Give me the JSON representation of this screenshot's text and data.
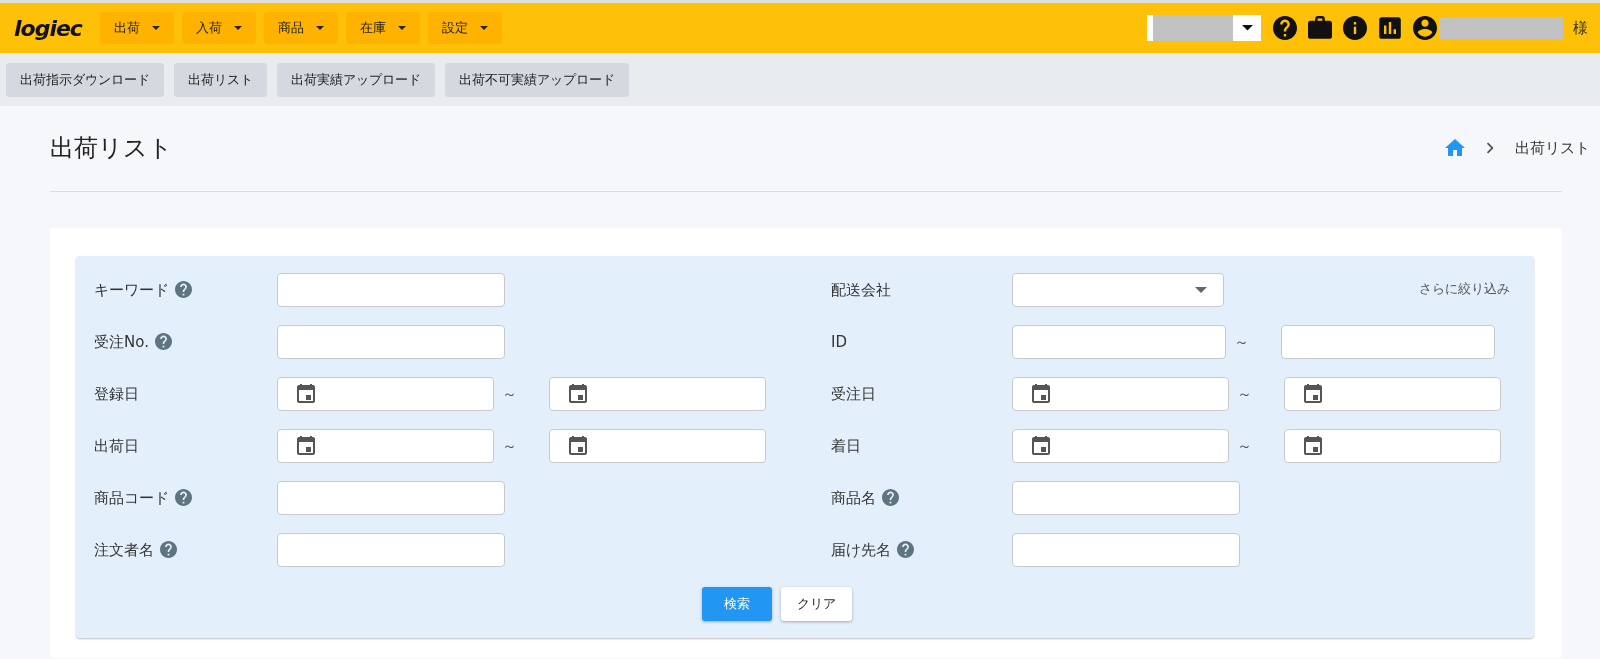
{
  "logo": "logiec",
  "menu": [
    {
      "label": "出荷"
    },
    {
      "label": "入荷"
    },
    {
      "label": "商品"
    },
    {
      "label": "在庫"
    },
    {
      "label": "設定"
    }
  ],
  "account": {
    "honorific": "様"
  },
  "subnav": [
    {
      "label": "出荷指示ダウンロード"
    },
    {
      "label": "出荷リスト"
    },
    {
      "label": "出荷実績アップロード"
    },
    {
      "label": "出荷不可実績アップロード"
    }
  ],
  "page_title": "出荷リスト",
  "breadcrumb": [
    "出荷リスト"
  ],
  "search_form": {
    "refine_link": "さらに絞り込み",
    "rows": [
      {
        "left": {
          "label": "キーワード",
          "help": true,
          "kind": "text"
        },
        "right": {
          "label": "配送会社",
          "help": false,
          "kind": "select"
        }
      },
      {
        "left": {
          "label": "受注No.",
          "help": true,
          "kind": "text"
        },
        "right": {
          "label": "ID",
          "help": false,
          "kind": "range",
          "separator": "～"
        }
      },
      {
        "left": {
          "label": "登録日",
          "help": false,
          "kind": "date_range",
          "separator": "～"
        },
        "right": {
          "label": "受注日",
          "help": false,
          "kind": "date_range",
          "separator": "～"
        }
      },
      {
        "left": {
          "label": "出荷日",
          "help": false,
          "kind": "date_range",
          "separator": "～"
        },
        "right": {
          "label": "着日",
          "help": false,
          "kind": "date_range",
          "separator": "～"
        }
      },
      {
        "left": {
          "label": "商品コード",
          "help": true,
          "kind": "text"
        },
        "right": {
          "label": "商品名",
          "help": true,
          "kind": "text"
        }
      },
      {
        "left": {
          "label": "注文者名",
          "help": true,
          "kind": "text"
        },
        "right": {
          "label": "届け先名",
          "help": true,
          "kind": "text"
        }
      }
    ],
    "buttons": [
      {
        "label": "検索",
        "kind": "primary"
      },
      {
        "label": "クリア",
        "kind": "secondary"
      }
    ]
  }
}
